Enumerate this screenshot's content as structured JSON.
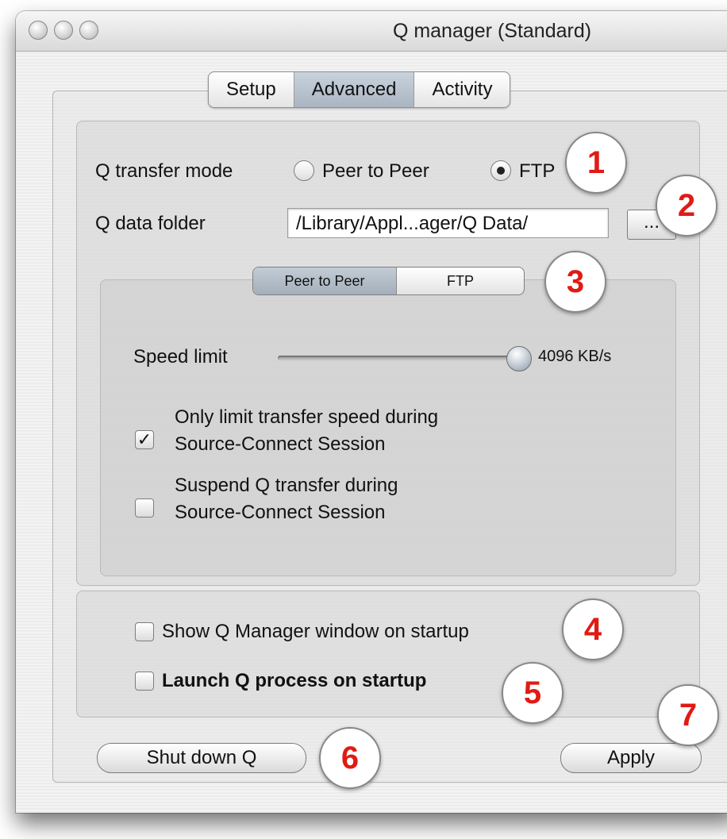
{
  "window": {
    "title": "Q manager (Standard)"
  },
  "tabs": [
    {
      "label": "Setup",
      "active": false
    },
    {
      "label": "Advanced",
      "active": true
    },
    {
      "label": "Activity",
      "active": false
    }
  ],
  "transfer": {
    "mode_label": "Q transfer mode",
    "option_peer": "Peer to Peer",
    "option_ftp": "FTP",
    "selected": "FTP",
    "folder_label": "Q data folder",
    "folder_value": "/Library/Appl...ager/Q Data/",
    "browse_label": "..."
  },
  "subtabs": [
    {
      "label": "Peer to Peer",
      "active": true
    },
    {
      "label": "FTP",
      "active": false
    }
  ],
  "speed": {
    "label": "Speed limit",
    "value_text": "4096 KB/s",
    "slider_fraction": 1.0
  },
  "options": {
    "limit_line1": "Only limit transfer speed during",
    "limit_line2": "Source-Connect Session",
    "limit_checked": true,
    "suspend_line1": "Suspend Q transfer during",
    "suspend_line2": "Source-Connect Session",
    "suspend_checked": false
  },
  "startup": {
    "show_window": "Show Q Manager window on startup",
    "show_window_checked": false,
    "launch_process": "Launch Q process on startup",
    "launch_process_checked": false
  },
  "buttons": {
    "shutdown": "Shut down Q",
    "apply": "Apply"
  },
  "callouts": [
    "1",
    "2",
    "3",
    "4",
    "5",
    "6",
    "7"
  ],
  "colors": {
    "callout_text": "#e01b14",
    "selected_tab": "#b4bfcb"
  }
}
